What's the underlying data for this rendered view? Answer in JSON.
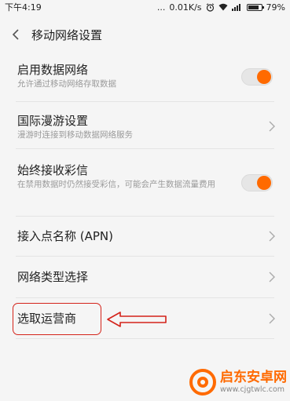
{
  "status_bar": {
    "time": "下午4:19",
    "dots": "...",
    "net_speed": "0.01K/s",
    "battery": "79%",
    "battery_level": 0.79
  },
  "header": {
    "title": "移动网络设置"
  },
  "settings": [
    {
      "title": "启用数据网络",
      "subtitle": "允许通过移动网络存取数据",
      "control": "toggle",
      "on": true
    },
    {
      "title": "国际漫游设置",
      "subtitle": "漫游时连接到移动数据网络服务",
      "control": "chevron"
    },
    {
      "title": "始终接收彩信",
      "subtitle": "在禁用数据时仍然接受彩信，可能会产生数据流量费用",
      "control": "toggle",
      "on": true
    },
    {
      "title": "接入点名称 (APN)",
      "control": "chevron"
    },
    {
      "title": "网络类型选择",
      "control": "chevron"
    },
    {
      "title": "选取运营商",
      "control": "chevron"
    }
  ],
  "annotation": {
    "color": "#d4231a",
    "highlighted_item": "选取运营商"
  },
  "watermark": {
    "name": "启东安卓网",
    "url": "www.cjgtwlc.com"
  },
  "colors": {
    "accent": "#ff6a00",
    "background": "#f5f5f5",
    "annotation": "#d4231a"
  }
}
